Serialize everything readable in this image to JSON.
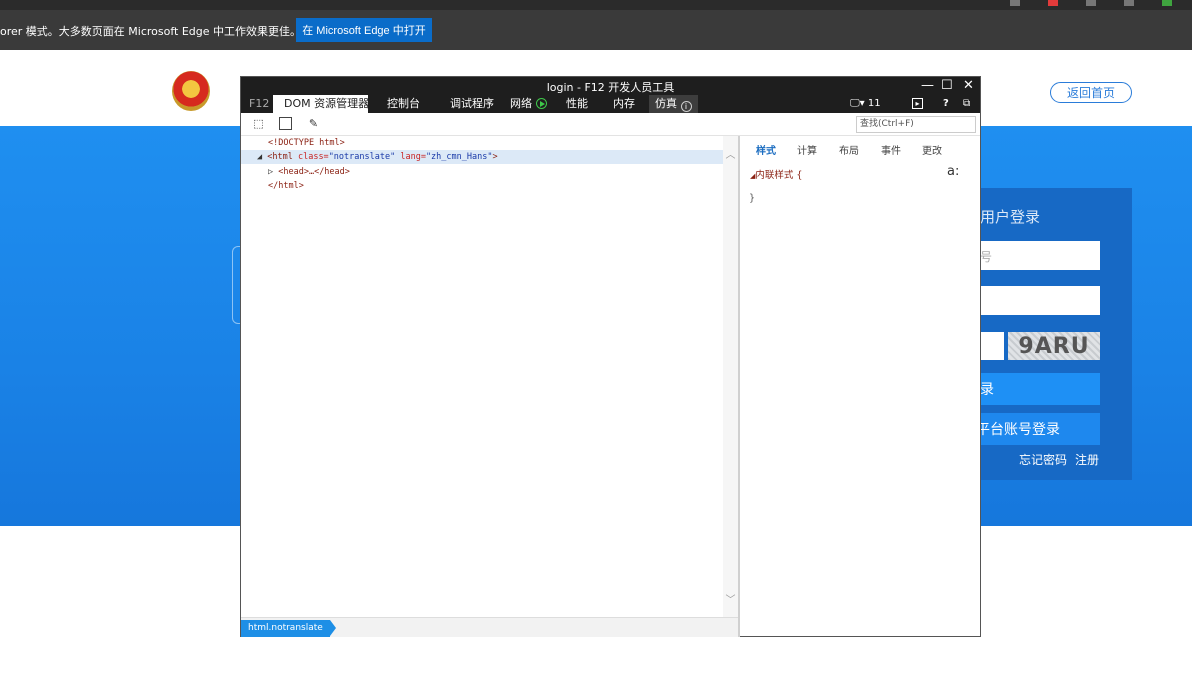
{
  "infobar": {
    "message": "orer 模式。大多数页面在 Microsoft Edge 中工作效果更佳。",
    "open_button": "在 Microsoft Edge 中打开"
  },
  "site": {
    "home_link": "返回首页",
    "login": {
      "title": "用户登录",
      "username_placeholder": "号",
      "captcha_text": "9ARU",
      "login_button": "录",
      "platform_button": "平台账号登录",
      "forgot_link": "忘记密码",
      "register_link": "注册"
    }
  },
  "devtools": {
    "title": "login - F12 开发人员工具",
    "window_controls": {
      "minimize": "—",
      "maximize": "☐",
      "close": "✕"
    },
    "tabs": {
      "f12": "F12",
      "dom": "DOM 资源管理器",
      "console": "控制台",
      "debugger": "调试程序",
      "network": "网络",
      "performance": "性能",
      "memory": "内存",
      "emulation": "仿真"
    },
    "right_controls": {
      "device_version": "11",
      "help": "?"
    },
    "search_placeholder": "查找(Ctrl+F)",
    "dom": {
      "doctype": "<!DOCTYPE html>",
      "html_open_tag": "<html",
      "html_class_attr": "class=",
      "html_class_val": "\"notranslate\"",
      "html_lang_attr": "lang=",
      "html_lang_val": "\"zh_cmn_Hans\"",
      "html_close_bracket": ">",
      "head_collapsed": "<head>…</head>",
      "html_close_tag": "</html>"
    },
    "breadcrumb": "html.notranslate",
    "style_tabs": {
      "styles": "样式",
      "computed": "计算",
      "layout": "布局",
      "events": "事件",
      "changes": "更改"
    },
    "styles": {
      "inline_label": "内联样式  {",
      "close_brace": "}",
      "aa": "a:"
    }
  }
}
